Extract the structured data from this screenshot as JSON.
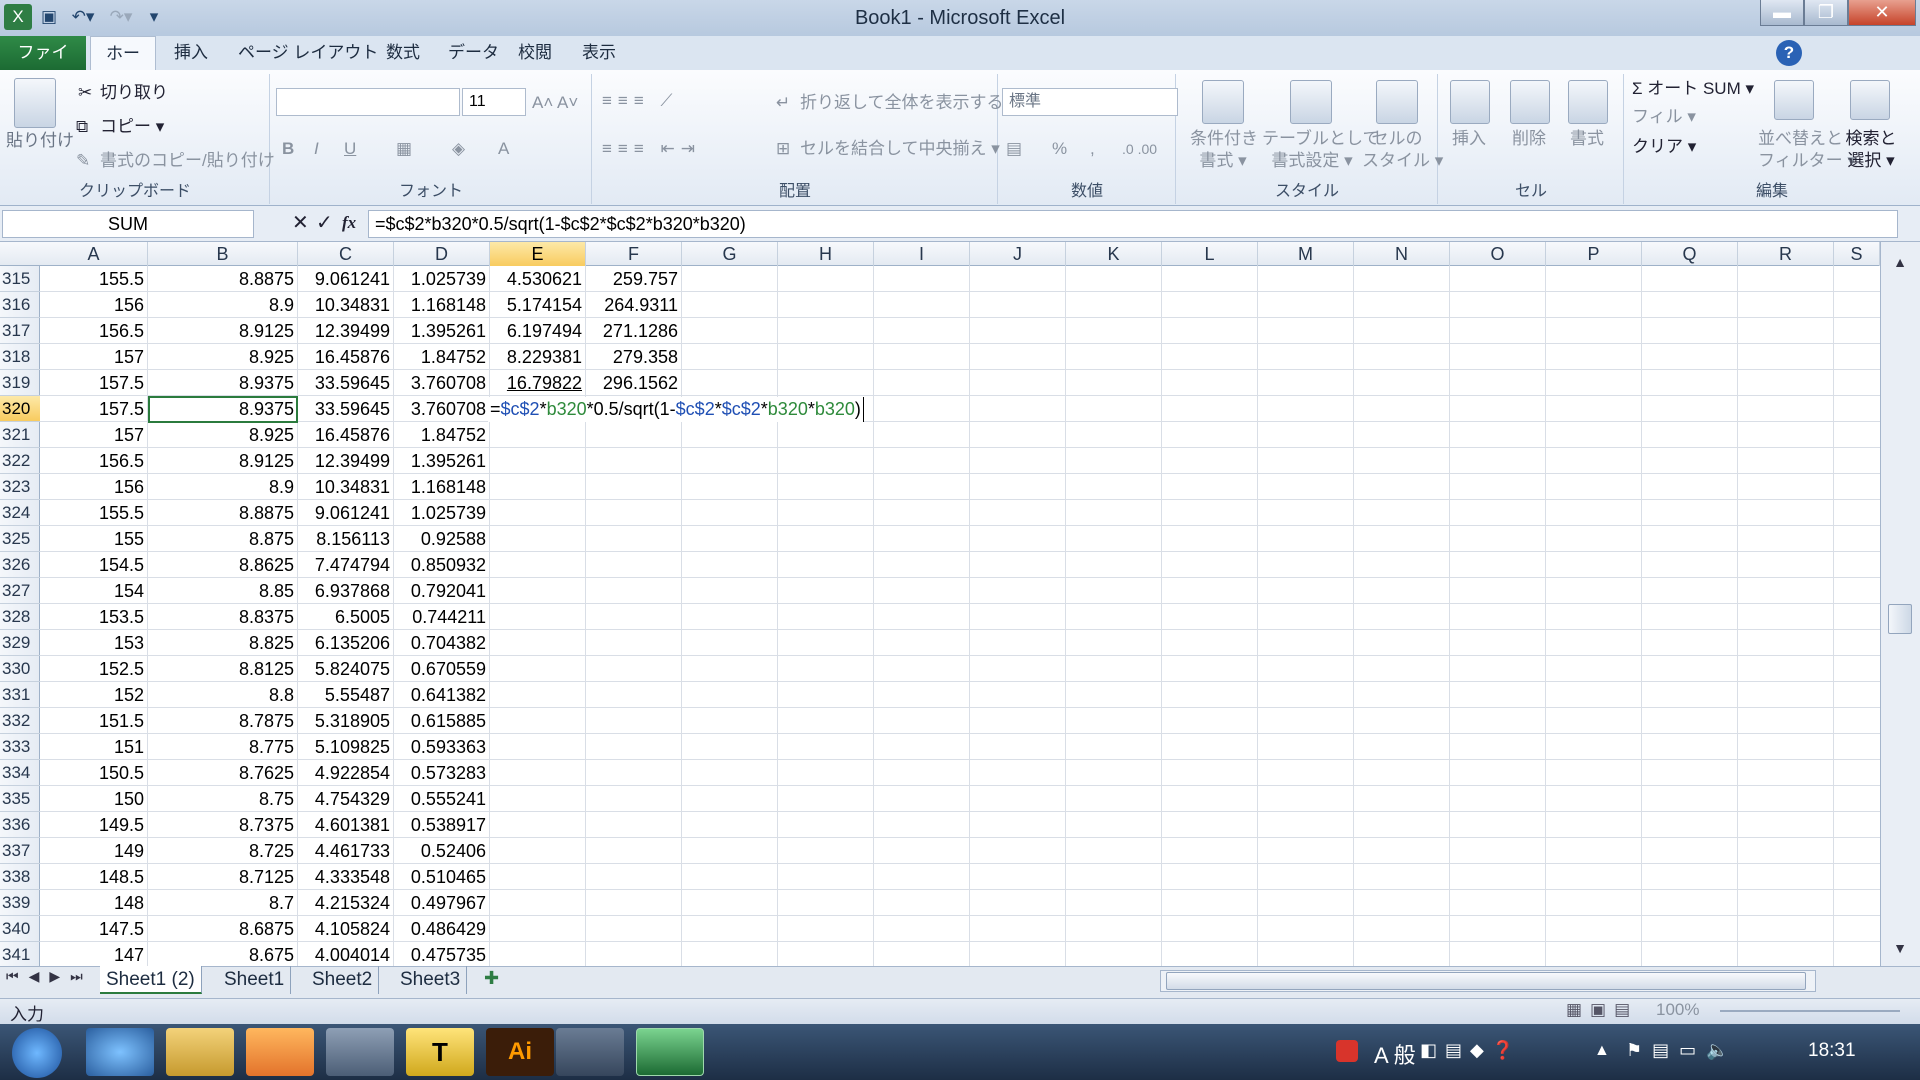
{
  "window": {
    "title": "Book1 - Microsoft Excel",
    "minimize": "▬",
    "restore": "❐",
    "close": "✕"
  },
  "ribbon_tabs": [
    "ファイル",
    "ホーム",
    "挿入",
    "ページ レイアウト",
    "数式",
    "データ",
    "校閲",
    "表示"
  ],
  "clipboard": {
    "paste": "貼り付け",
    "cut": "切り取り",
    "copy": "コピー ▾",
    "format_painter": "書式のコピー/貼り付け",
    "label": "クリップボード"
  },
  "font": {
    "size": "11",
    "bold": "B",
    "italic": "I",
    "underline": "U",
    "label": "フォント"
  },
  "alignment": {
    "wrap": "折り返して全体を表示する",
    "merge": "セルを結合して中央揃え ▾",
    "label": "配置"
  },
  "number": {
    "format": "標準",
    "percent": "%",
    "comma": ",",
    "label": "数値"
  },
  "styles": {
    "conditional": "条件付き\n書式 ▾",
    "table": "テーブルとして\n書式設定 ▾",
    "cell": "セルの\nスタイル ▾",
    "label": "スタイル"
  },
  "cells": {
    "insert": "挿入",
    "delete": "削除",
    "format": "書式",
    "label": "セル"
  },
  "editing": {
    "autosum": "Σ オート SUM ▾",
    "fill": "フィル ▾",
    "clear": "クリア ▾",
    "sort": "並べ替えと\nフィルター ▾",
    "find": "検索と\n選択 ▾",
    "label": "編集"
  },
  "formula_bar": {
    "name_box": "SUM",
    "cancel": "✕",
    "enter": "✓",
    "fx": "fx",
    "formula": "=$c$2*b320*0.5/sqrt(1-$c$2*$c$2*b320*b320)"
  },
  "columns": [
    "A",
    "B",
    "C",
    "D",
    "E",
    "F",
    "G",
    "H",
    "I",
    "J",
    "K",
    "L",
    "M",
    "N",
    "O",
    "P",
    "Q",
    "R",
    "S"
  ],
  "rows": [
    {
      "n": "315",
      "a": "155.5",
      "b": "8.8875",
      "c": "9.061241",
      "d": "1.025739",
      "e": "4.530621",
      "f": "259.757"
    },
    {
      "n": "316",
      "a": "156",
      "b": "8.9",
      "c": "10.34831",
      "d": "1.168148",
      "e": "5.174154",
      "f": "264.9311"
    },
    {
      "n": "317",
      "a": "156.5",
      "b": "8.9125",
      "c": "12.39499",
      "d": "1.395261",
      "e": "6.197494",
      "f": "271.1286"
    },
    {
      "n": "318",
      "a": "157",
      "b": "8.925",
      "c": "16.45876",
      "d": "1.84752",
      "e": "8.229381",
      "f": "279.358"
    },
    {
      "n": "319",
      "a": "157.5",
      "b": "8.9375",
      "c": "33.59645",
      "d": "3.760708",
      "e": "16.79822",
      "f": "296.1562"
    },
    {
      "n": "320",
      "a": "157.5",
      "b": "8.9375",
      "c": "33.59645",
      "d": "3.760708",
      "e": "",
      "f": ""
    },
    {
      "n": "321",
      "a": "157",
      "b": "8.925",
      "c": "16.45876",
      "d": "1.84752",
      "e": "",
      "f": ""
    },
    {
      "n": "322",
      "a": "156.5",
      "b": "8.9125",
      "c": "12.39499",
      "d": "1.395261",
      "e": "",
      "f": ""
    },
    {
      "n": "323",
      "a": "156",
      "b": "8.9",
      "c": "10.34831",
      "d": "1.168148",
      "e": "",
      "f": ""
    },
    {
      "n": "324",
      "a": "155.5",
      "b": "8.8875",
      "c": "9.061241",
      "d": "1.025739",
      "e": "",
      "f": ""
    },
    {
      "n": "325",
      "a": "155",
      "b": "8.875",
      "c": "8.156113",
      "d": "0.92588",
      "e": "",
      "f": ""
    },
    {
      "n": "326",
      "a": "154.5",
      "b": "8.8625",
      "c": "7.474794",
      "d": "0.850932",
      "e": "",
      "f": ""
    },
    {
      "n": "327",
      "a": "154",
      "b": "8.85",
      "c": "6.937868",
      "d": "0.792041",
      "e": "",
      "f": ""
    },
    {
      "n": "328",
      "a": "153.5",
      "b": "8.8375",
      "c": "6.5005",
      "d": "0.744211",
      "e": "",
      "f": ""
    },
    {
      "n": "329",
      "a": "153",
      "b": "8.825",
      "c": "6.135206",
      "d": "0.704382",
      "e": "",
      "f": ""
    },
    {
      "n": "330",
      "a": "152.5",
      "b": "8.8125",
      "c": "5.824075",
      "d": "0.670559",
      "e": "",
      "f": ""
    },
    {
      "n": "331",
      "a": "152",
      "b": "8.8",
      "c": "5.55487",
      "d": "0.641382",
      "e": "",
      "f": ""
    },
    {
      "n": "332",
      "a": "151.5",
      "b": "8.7875",
      "c": "5.318905",
      "d": "0.615885",
      "e": "",
      "f": ""
    },
    {
      "n": "333",
      "a": "151",
      "b": "8.775",
      "c": "5.109825",
      "d": "0.593363",
      "e": "",
      "f": ""
    },
    {
      "n": "334",
      "a": "150.5",
      "b": "8.7625",
      "c": "4.922854",
      "d": "0.573283",
      "e": "",
      "f": ""
    },
    {
      "n": "335",
      "a": "150",
      "b": "8.75",
      "c": "4.754329",
      "d": "0.555241",
      "e": "",
      "f": ""
    },
    {
      "n": "336",
      "a": "149.5",
      "b": "8.7375",
      "c": "4.601381",
      "d": "0.538917",
      "e": "",
      "f": ""
    },
    {
      "n": "337",
      "a": "149",
      "b": "8.725",
      "c": "4.461733",
      "d": "0.52406",
      "e": "",
      "f": ""
    },
    {
      "n": "338",
      "a": "148.5",
      "b": "8.7125",
      "c": "4.333548",
      "d": "0.510465",
      "e": "",
      "f": ""
    },
    {
      "n": "339",
      "a": "148",
      "b": "8.7",
      "c": "4.215324",
      "d": "0.497967",
      "e": "",
      "f": ""
    },
    {
      "n": "340",
      "a": "147.5",
      "b": "8.6875",
      "c": "4.105824",
      "d": "0.486429",
      "e": "",
      "f": ""
    },
    {
      "n": "341",
      "a": "147",
      "b": "8.675",
      "c": "4.004014",
      "d": "0.475735",
      "e": "",
      "f": ""
    }
  ],
  "editing_cell": {
    "p1": "=",
    "p2": "$c$2",
    "p3": "*",
    "p4": "b320",
    "p5": "*0.5/sqrt(1-",
    "p6": "$c$2",
    "p7": "*",
    "p8": "$c$2",
    "p9": "*",
    "p10": "b320",
    "p11": "*",
    "p12": "b320",
    "p13": ")"
  },
  "sheets": [
    "Sheet1 (2)",
    "Sheet1",
    "Sheet2",
    "Sheet3"
  ],
  "status": {
    "mode": "入力",
    "zoom": "100%"
  },
  "taskbar": {
    "ime": "A 般",
    "clock": "18:31",
    "ai_label": "Ai",
    "t_label": "T"
  }
}
